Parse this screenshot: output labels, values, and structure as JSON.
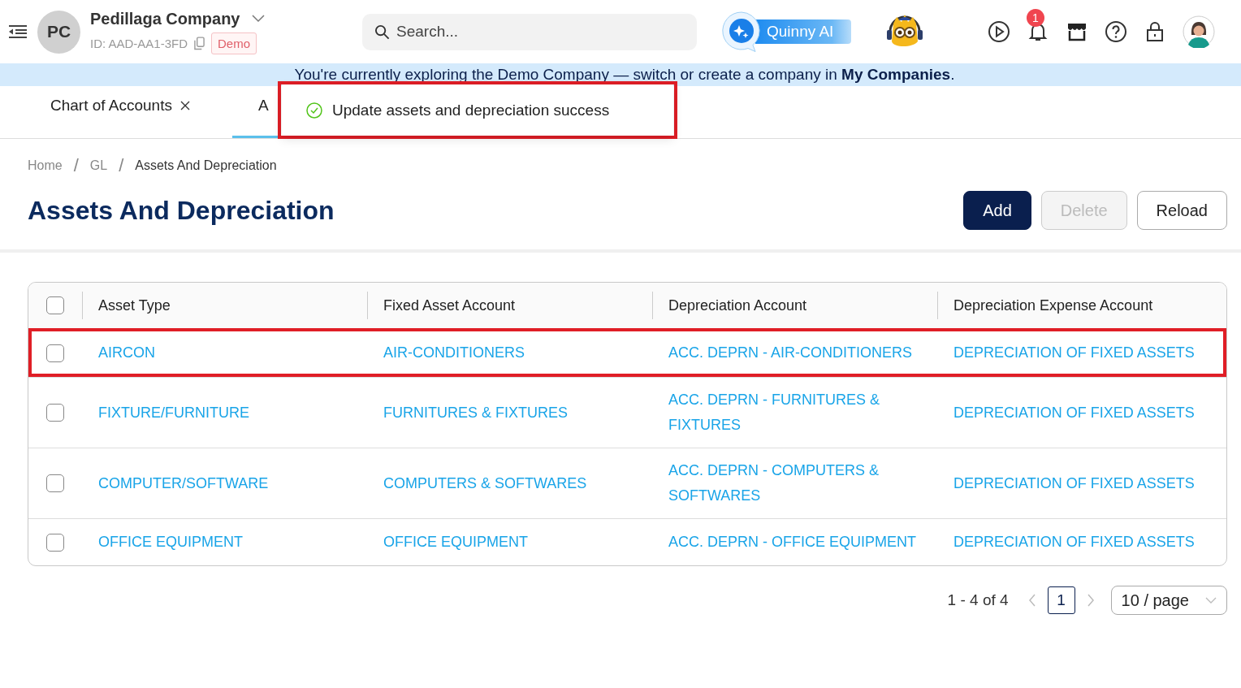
{
  "header": {
    "company_initials": "PC",
    "company_name": "Pedillaga Company",
    "company_id": "ID: AAD-AA1-3FD",
    "badge": "Demo",
    "search": {
      "placeholder": "Search..."
    },
    "ai_button": "Quinny AI",
    "notification_count": "1"
  },
  "banner": {
    "text": "You're currently exploring the Demo Company — switch or create a company in **My Companies**."
  },
  "tabs": [
    {
      "label": "Chart of Accounts",
      "selected": false,
      "closable": true
    },
    {
      "label": "A",
      "selected": true,
      "closable": false
    }
  ],
  "toast": {
    "message": "Update assets and depreciation success",
    "highlighted": true
  },
  "breadcrumb": [
    {
      "kind": "link",
      "text": "Home"
    },
    {
      "kind": "separator",
      "text": "/"
    },
    {
      "kind": "link",
      "text": "GL"
    },
    {
      "kind": "separator",
      "text": "/"
    },
    {
      "kind": "current",
      "text": "Assets And Depreciation"
    }
  ],
  "page_title": "Assets And Depreciation",
  "buttons": [
    {
      "label": "Add",
      "kind": "primary",
      "disabled": false
    },
    {
      "label": "Delete",
      "kind": "default",
      "disabled": true
    },
    {
      "label": "Reload",
      "kind": "default",
      "disabled": false
    }
  ],
  "table": {
    "header_checked": false,
    "columns": [
      "Asset Type",
      "Fixed Asset Account",
      "Depreciation Account",
      "Depreciation Expense Account"
    ],
    "rows": [
      {
        "checked": false,
        "highlighted": true,
        "cells": [
          "AIRCON",
          "AIR-CONDITIONERS",
          "ACC. DEPRN - AIR-CONDITIONERS",
          "DEPRECIATION OF FIXED ASSETS"
        ]
      },
      {
        "checked": false,
        "highlighted": false,
        "cells": [
          "FIXTURE/FURNITURE",
          "FURNITURES & FIXTURES",
          "ACC. DEPRN - FURNITURES & FIXTURES",
          "DEPRECIATION OF FIXED ASSETS"
        ]
      },
      {
        "checked": false,
        "highlighted": false,
        "cells": [
          "COMPUTER/SOFTWARE",
          "COMPUTERS & SOFTWARES",
          "ACC. DEPRN - COMPUTERS & SOFTWARES",
          "DEPRECIATION OF FIXED ASSETS"
        ]
      },
      {
        "checked": false,
        "highlighted": false,
        "cells": [
          "OFFICE EQUIPMENT",
          "OFFICE EQUIPMENT",
          "ACC. DEPRN - OFFICE EQUIPMENT",
          "DEPRECIATION OF FIXED ASSETS"
        ]
      }
    ]
  },
  "pagination": {
    "range": "1 - 4 of 4",
    "pages": [
      {
        "label": "1",
        "selected": true
      }
    ],
    "page_size": "10 / page"
  }
}
